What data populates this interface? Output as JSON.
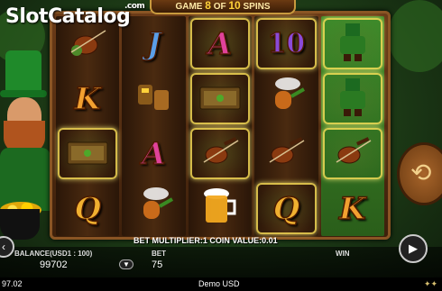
{
  "header": {
    "logo_text": "SlotCatalog",
    "logo_suffix": ".com",
    "spins_prefix": "GAME",
    "spins_current": "8",
    "spins_of": "OF",
    "spins_total": "10",
    "spins_suffix": "SPINS"
  },
  "reels": [
    [
      "wild-fiddle-icon",
      "K",
      "book-icon",
      "Q"
    ],
    [
      "J",
      "boots-icon",
      "A",
      "pipe-icon"
    ],
    [
      "A",
      "book-icon",
      "fiddle-icon",
      "beer-mug-icon"
    ],
    [
      "10",
      "pipe-icon",
      "fiddle-icon",
      "Q"
    ],
    [
      "wild-leprechaun-icon",
      "wild-leprechaun-icon",
      "fiddle-icon",
      "K"
    ]
  ],
  "win_cells": [
    [
      0,
      2
    ],
    [
      2,
      0
    ],
    [
      2,
      1
    ],
    [
      2,
      2
    ],
    [
      3,
      0
    ],
    [
      3,
      3
    ],
    [
      4,
      0
    ],
    [
      4,
      1
    ],
    [
      4,
      2
    ]
  ],
  "multiplier_text": "BET MULTIPLIER:1 COIN VALUE:0.01",
  "controls": {
    "balance_label": "BALANCE(USD1 : 100)",
    "balance_value": "99702",
    "bet_label": "BET",
    "bet_value": "75",
    "win_label": "WIN"
  },
  "footer": {
    "left_value": "97.02",
    "center_text": "Demo USD"
  },
  "colors": {
    "frame": "#6b3b18",
    "win_glow": "#ffe45a",
    "banner_text": "#ffd23a"
  }
}
